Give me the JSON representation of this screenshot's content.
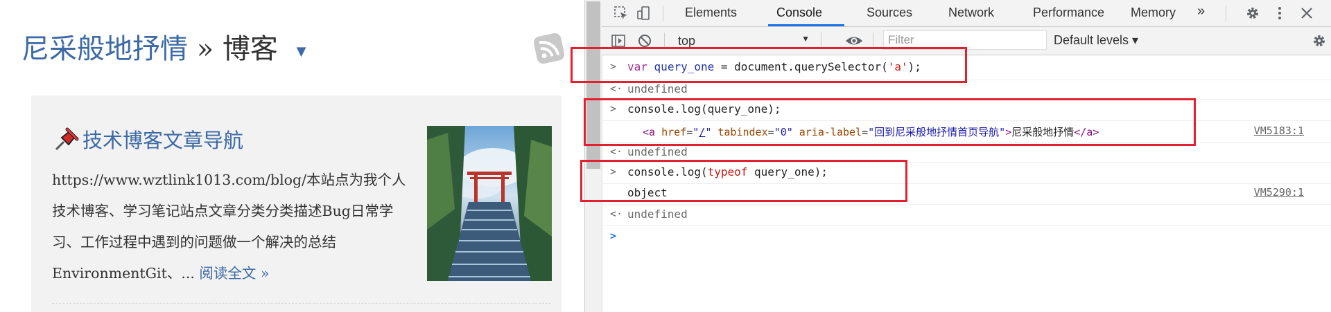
{
  "blog": {
    "site_name": "尼采般地抒情",
    "separator": "»",
    "section": "博客",
    "post": {
      "title": "技术博客文章导航",
      "excerpt": "https://www.wztlink1013.com/blog/本站点为我个人技术博客、学习笔记站点文章分类分类描述Bug日常学习、工作过程中遇到的问题做一个解决的总结EnvironmentGit、...",
      "read_more": "阅读全文 »"
    }
  },
  "devtools": {
    "tabs": [
      {
        "label": "Elements",
        "active": false
      },
      {
        "label": "Console",
        "active": true
      },
      {
        "label": "Sources",
        "active": false
      },
      {
        "label": "Network",
        "active": false
      },
      {
        "label": "Performance",
        "active": false
      },
      {
        "label": "Memory",
        "active": false
      }
    ],
    "overflow_glyph": "»",
    "context_value": "top",
    "filter_placeholder": "Filter",
    "levels_label": "Default levels ▾",
    "console": {
      "input1": {
        "kw": "var",
        "name": "query_one",
        "eq": " = ",
        "call": "document.querySelector(",
        "arg": "'a'",
        "end": ");"
      },
      "undef_text": "undefined",
      "input2": "console.log(query_one);",
      "output2": {
        "lt": "<",
        "tag": "a",
        "attr_href": "href",
        "eq": "=",
        "q": "\"",
        "href_val": "/",
        "attr_tabindex": "tabindex",
        "tabindex_val": "0",
        "attr_aria": "aria-label",
        "aria_val": "回到尼采般地抒情首页导航",
        "gt": ">",
        "text": "尼采般地抒情",
        "close": "</a>",
        "source": "VM5183:1"
      },
      "input3": {
        "pre": "console.log(",
        "kw": "typeof",
        "post": " query_one);"
      },
      "output3": {
        "text": "object",
        "source": "VM5290:1"
      }
    }
  },
  "colors": {
    "link_blue": "#3d6aa6",
    "highlight_red": "#e5202e",
    "devtools_accent": "#1a73e8"
  },
  "icons": [
    "rss-icon",
    "pin-icon",
    "inspect-icon",
    "device-toolbar-icon",
    "sidebar-toggle-icon",
    "clear-console-icon",
    "eye-icon",
    "gear-icon",
    "kebab-menu-icon",
    "close-icon"
  ]
}
